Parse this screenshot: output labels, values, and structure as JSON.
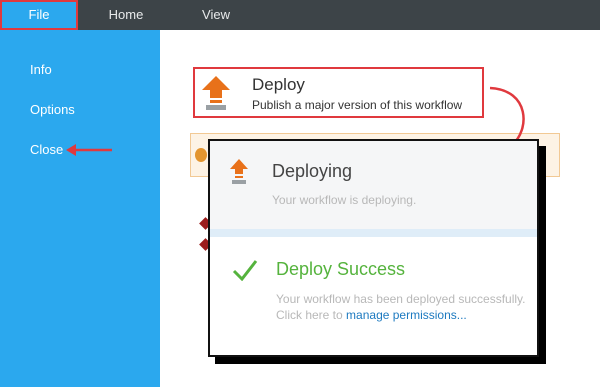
{
  "topbar": {
    "tabs": [
      {
        "label": "File"
      },
      {
        "label": "Home"
      },
      {
        "label": "View"
      }
    ]
  },
  "sidebar": {
    "items": [
      {
        "label": "Info"
      },
      {
        "label": "Options"
      },
      {
        "label": "Close"
      }
    ]
  },
  "deploy": {
    "title": "Deploy",
    "description": "Publish a major version of this workflow",
    "icon": "deploy-arrow-icon"
  },
  "status": {
    "deploying_title": "Deploying",
    "deploying_desc": "Your workflow is deploying.",
    "success_title": "Deploy Success",
    "success_desc": "Your workflow has been deployed successfully. Click here to",
    "success_link": "manage permissions..."
  },
  "colors": {
    "topbar": "#3d4448",
    "sidebar": "#2ba8ee",
    "highlight": "#e0393e",
    "icon_orange": "#e8711a",
    "success": "#55b33d",
    "link": "#1d7ac0"
  }
}
